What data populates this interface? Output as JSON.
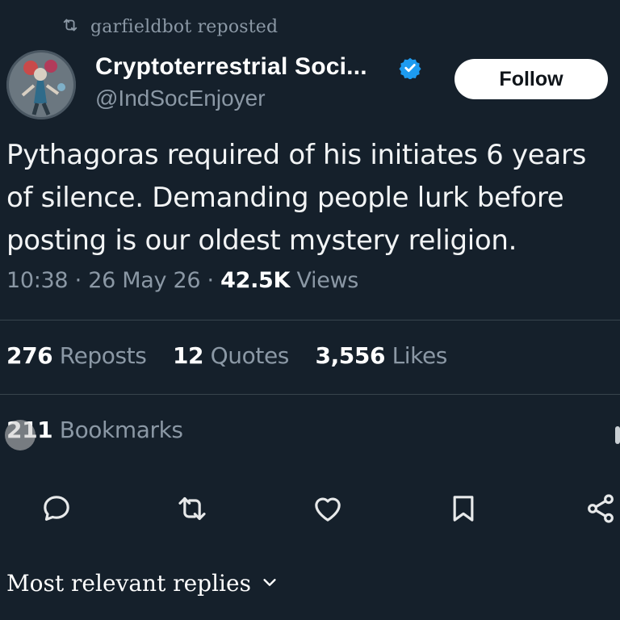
{
  "repost": {
    "icon": "repost-icon",
    "text": "garfieldbot reposted"
  },
  "author": {
    "avatar": "avatar",
    "display_name": "Cryptoterrestrial Soci...",
    "verified_icon": "verified-badge-icon",
    "handle": "@IndSocEnjoyer"
  },
  "follow_button": {
    "label": "Follow"
  },
  "tweet": {
    "lines": [
      "Pythagoras required of his initiates 6 years",
      "of silence. Demanding people lurk before",
      "posting is our oldest mystery religion."
    ]
  },
  "meta": {
    "time": "10:38",
    "sep1": "·",
    "date": "26 May 26",
    "sep2": "·",
    "views_count": "42.5K",
    "views_label": "Views"
  },
  "stats": {
    "reposts": {
      "count": "276",
      "label": "Reposts"
    },
    "quotes": {
      "count": "12",
      "label": "Quotes"
    },
    "likes": {
      "count": "3,556",
      "label": "Likes"
    },
    "bookmarks": {
      "count": "211",
      "label": "Bookmarks"
    }
  },
  "actions": [
    "reply-icon",
    "repost-icon",
    "like-icon",
    "bookmark-icon",
    "share-icon"
  ],
  "replies": {
    "label": "Most relevant replies",
    "icon": "chevron-down-icon"
  },
  "colors": {
    "background": "#15202b",
    "text_primary": "#ffffff",
    "text_secondary": "#8b98a5",
    "divider": "#38444d",
    "verified": "#1d9bf0",
    "follow_bg": "#ffffff"
  }
}
